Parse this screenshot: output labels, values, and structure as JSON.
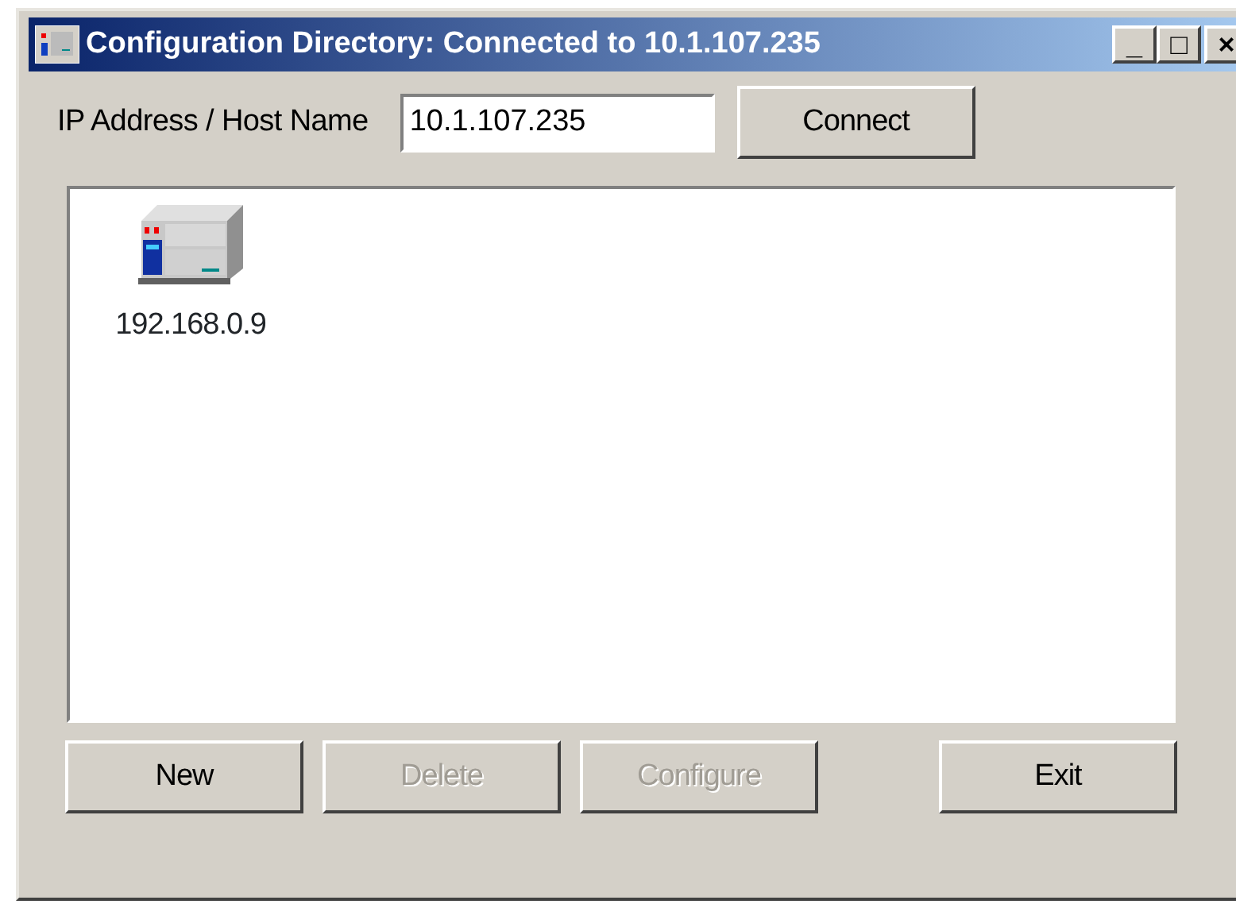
{
  "window": {
    "title": "Configuration Directory: Connected to 10.1.107.235",
    "controls": [
      "_",
      "□",
      "×"
    ]
  },
  "address": {
    "label": "IP Address / Host Name",
    "value": "10.1.107.235",
    "button": "Connect"
  },
  "devices": [
    {
      "label": "192.168.0.9",
      "selected": false
    }
  ],
  "buttons": [
    {
      "label": "New",
      "disabled": false
    },
    {
      "label": "Delete",
      "disabled": true
    },
    {
      "label": "Configure",
      "disabled": true
    },
    {
      "label": "Exit",
      "disabled": false
    }
  ]
}
